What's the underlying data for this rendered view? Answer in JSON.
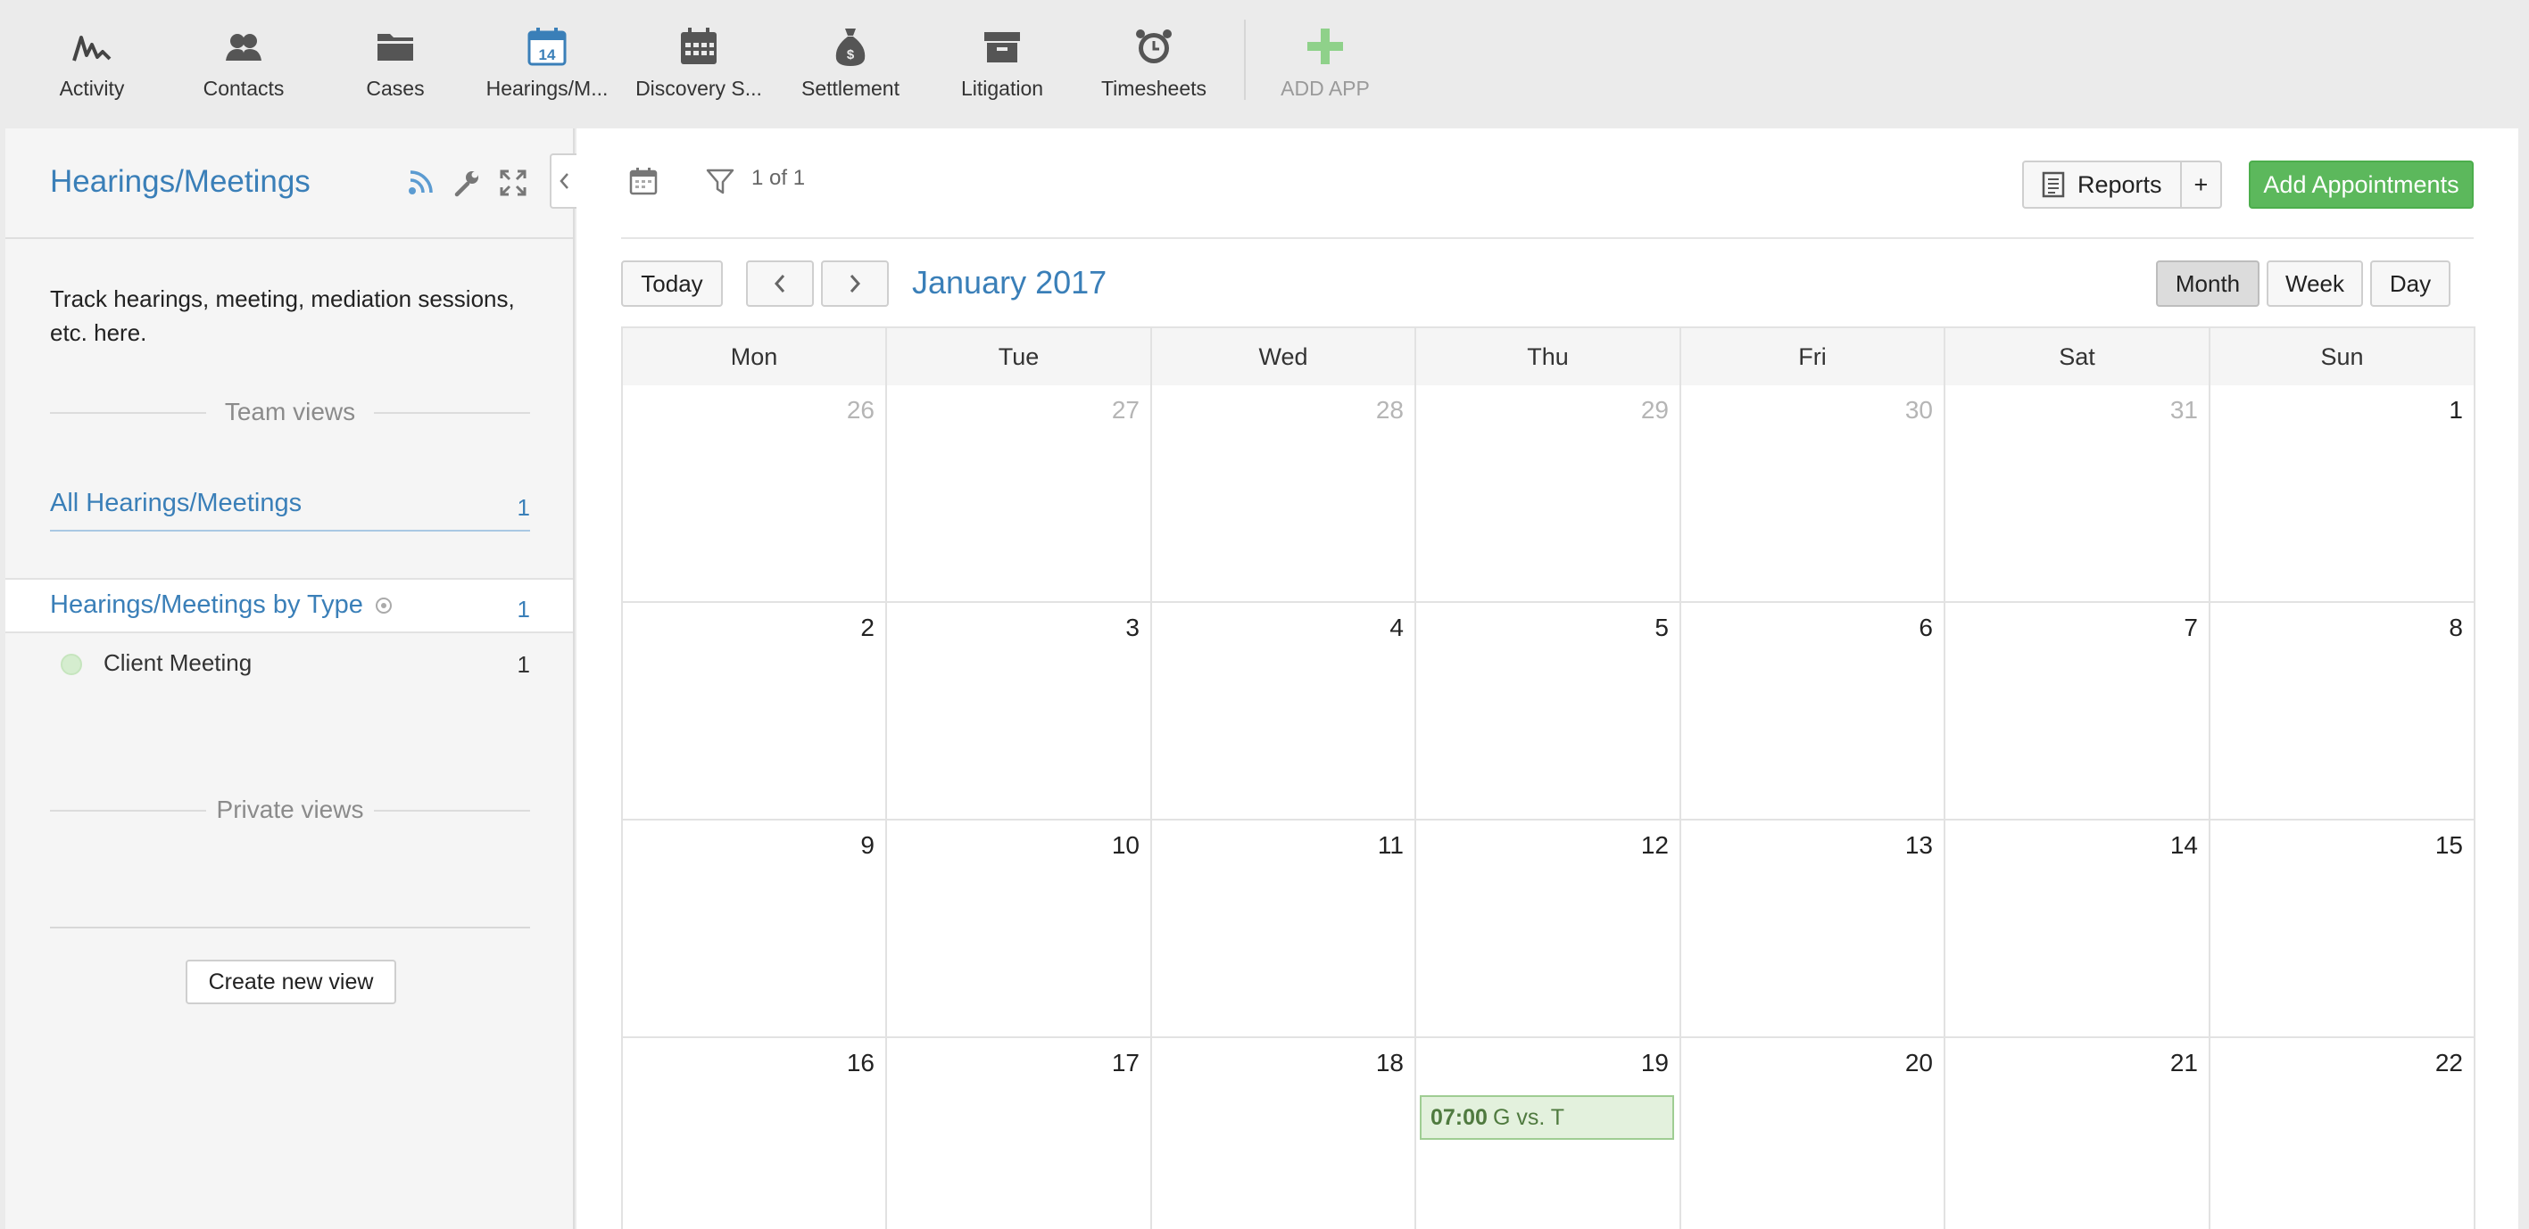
{
  "apps": [
    {
      "id": "activity",
      "label": "Activity",
      "icon": "activity-icon"
    },
    {
      "id": "contacts",
      "label": "Contacts",
      "icon": "contacts-icon"
    },
    {
      "id": "cases",
      "label": "Cases",
      "icon": "folder-icon"
    },
    {
      "id": "hearings",
      "label": "Hearings/M...",
      "icon": "calendar-14-icon",
      "calendar_day": "14"
    },
    {
      "id": "discovery",
      "label": "Discovery S...",
      "icon": "calendar-grid-icon"
    },
    {
      "id": "settlement",
      "label": "Settlement",
      "icon": "money-bag-icon"
    },
    {
      "id": "litigation",
      "label": "Litigation",
      "icon": "archive-box-icon"
    },
    {
      "id": "timesheets",
      "label": "Timesheets",
      "icon": "alarm-clock-icon"
    }
  ],
  "add_app": {
    "label": "ADD APP",
    "icon": "plus-icon"
  },
  "sidebar": {
    "title": "Hearings/Meetings",
    "description": "Track hearings, meeting, mediation sessions, etc. here.",
    "team_views_label": "Team views",
    "all_views": {
      "label": "All Hearings/Meetings",
      "count": "1"
    },
    "by_type": {
      "label": "Hearings/Meetings by Type",
      "count": "1"
    },
    "type_items": [
      {
        "label": "Client Meeting",
        "count": "1"
      }
    ],
    "private_views_label": "Private views",
    "create_view_label": "Create new view"
  },
  "toolbar": {
    "page_count": "1 of 1",
    "reports_label": "Reports",
    "plus_label": "+",
    "add_appointments_label": "Add Appointments"
  },
  "calendar": {
    "today_label": "Today",
    "month_title": "January 2017",
    "view_buttons": [
      {
        "label": "Month",
        "active": true
      },
      {
        "label": "Week",
        "active": false
      },
      {
        "label": "Day",
        "active": false
      }
    ],
    "day_headers": [
      "Mon",
      "Tue",
      "Wed",
      "Thu",
      "Fri",
      "Sat",
      "Sun"
    ],
    "weeks": [
      [
        {
          "n": "26",
          "other": true
        },
        {
          "n": "27",
          "other": true
        },
        {
          "n": "28",
          "other": true
        },
        {
          "n": "29",
          "other": true
        },
        {
          "n": "30",
          "other": true
        },
        {
          "n": "31",
          "other": true
        },
        {
          "n": "1",
          "other": false
        }
      ],
      [
        {
          "n": "2"
        },
        {
          "n": "3"
        },
        {
          "n": "4"
        },
        {
          "n": "5"
        },
        {
          "n": "6"
        },
        {
          "n": "7"
        },
        {
          "n": "8"
        }
      ],
      [
        {
          "n": "9"
        },
        {
          "n": "10"
        },
        {
          "n": "11"
        },
        {
          "n": "12"
        },
        {
          "n": "13"
        },
        {
          "n": "14"
        },
        {
          "n": "15"
        }
      ],
      [
        {
          "n": "16"
        },
        {
          "n": "17"
        },
        {
          "n": "18"
        },
        {
          "n": "19",
          "event": {
            "time": "07:00",
            "title": "G vs. T"
          }
        },
        {
          "n": "20"
        },
        {
          "n": "21"
        },
        {
          "n": "22"
        }
      ]
    ]
  },
  "colors": {
    "accent": "#3a7fb8",
    "primary_button": "#5cb85c",
    "event_bg": "#e3f1dd",
    "event_border": "#9fcd93",
    "add_app": "#8fd18a"
  }
}
